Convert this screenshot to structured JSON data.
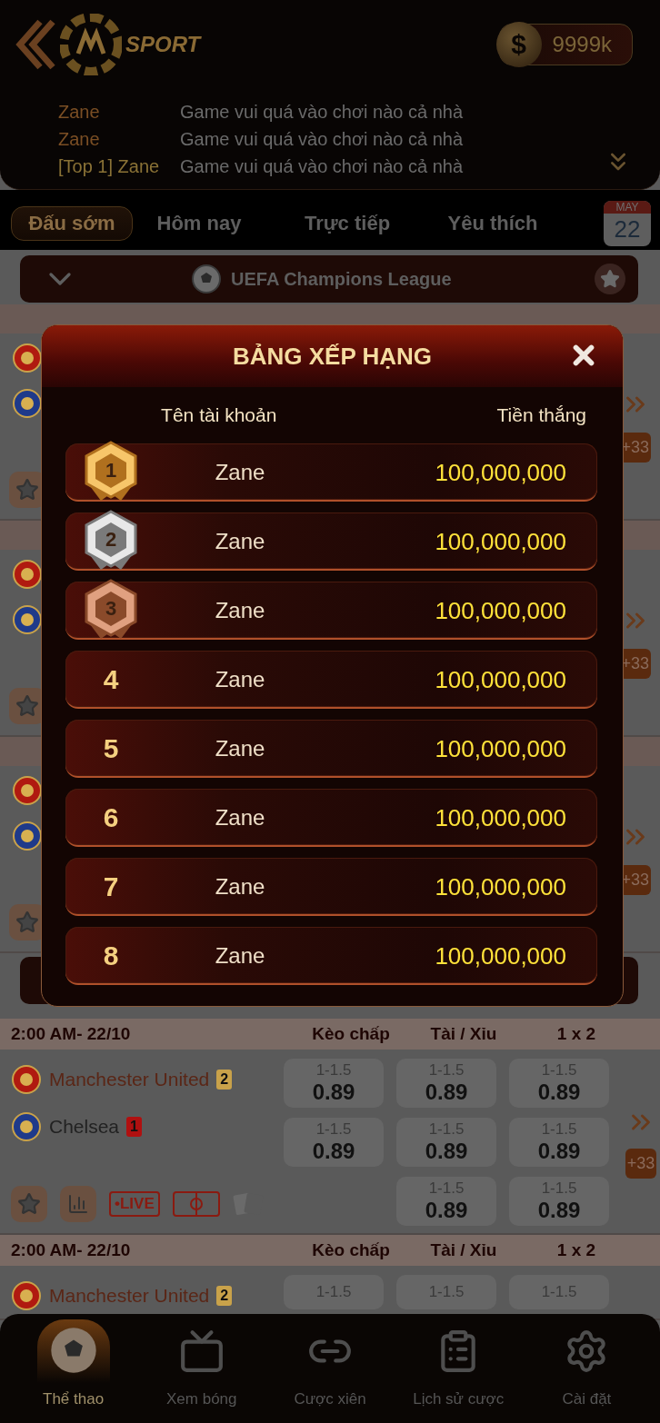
{
  "header": {
    "brand": "SPORT",
    "currency_symbol": "$",
    "balance": "9999k"
  },
  "chat": [
    {
      "user": "Zane",
      "message": "Game vui quá vào chơi nào cả nhà",
      "highlight": false
    },
    {
      "user": "Zane",
      "message": "Game vui quá vào chơi nào cả nhà",
      "highlight": false
    },
    {
      "user": "[Top 1] Zane",
      "message": "Game vui quá vào chơi nào cả nhà",
      "highlight": true
    }
  ],
  "tabs": [
    {
      "label": "Đấu sớm",
      "selected": true
    },
    {
      "label": "Hôm nay",
      "selected": false
    },
    {
      "label": "Trực tiếp",
      "selected": false
    },
    {
      "label": "Yêu thích",
      "selected": false
    }
  ],
  "calendar": {
    "month": "MAY",
    "day": "22"
  },
  "league": {
    "name": "UEFA Champions League"
  },
  "hidden_matches": [
    {
      "more": "+33"
    },
    {
      "more": "+33"
    },
    {
      "more": "+33"
    }
  ],
  "matches": [
    {
      "time": "2:00 AM- 22/10",
      "teams": [
        {
          "name": "Manchester United",
          "card": "2",
          "color": "#c9a24a",
          "kind": "red-devil"
        },
        {
          "name": "Chelsea",
          "card": "1",
          "color": "#b01010",
          "kind": "lion"
        }
      ],
      "markets": [
        {
          "title": "Kèo chấp",
          "odds": [
            {
              "line": "1-1.5",
              "price": "0.89"
            },
            {
              "line": "1-1.5",
              "price": "0.89"
            }
          ]
        },
        {
          "title": "Tài / Xỉu",
          "odds": [
            {
              "line": "1-1.5",
              "price": "0.89"
            },
            {
              "line": "1-1.5",
              "price": "0.89"
            },
            {
              "line": "1-1.5",
              "price": "0.89"
            }
          ]
        },
        {
          "title": "1 x 2",
          "odds": [
            {
              "line": "1-1.5",
              "price": "0.89"
            },
            {
              "line": "1-1.5",
              "price": "0.89"
            },
            {
              "line": "1-1.5",
              "price": "0.89"
            }
          ]
        }
      ],
      "live": "•LIVE",
      "more": "+33"
    },
    {
      "time": "2:00 AM- 22/10",
      "teams": [
        {
          "name": "Manchester United",
          "card": "2",
          "color": "#c9a24a",
          "kind": "red-devil"
        }
      ],
      "markets": [
        {
          "title": "Kèo chấp",
          "odds": [
            {
              "line": "1-1.5"
            }
          ]
        },
        {
          "title": "Tài / Xỉu",
          "odds": [
            {
              "line": "1-1.5"
            }
          ]
        },
        {
          "title": "1 x 2",
          "odds": [
            {
              "line": "1-1.5"
            }
          ]
        }
      ]
    }
  ],
  "leaderboard": {
    "title": "BẢNG XẾP HẠNG",
    "columns": [
      "Tên tài khoản",
      "Tiền thắng"
    ],
    "rows": [
      {
        "rank": "1",
        "kind": "gold",
        "name": "Zane",
        "amount": "100,000,000"
      },
      {
        "rank": "2",
        "kind": "silver",
        "name": "Zane",
        "amount": "100,000,000"
      },
      {
        "rank": "3",
        "kind": "bronze",
        "name": "Zane",
        "amount": "100,000,000"
      },
      {
        "rank": "4",
        "kind": "plain",
        "name": "Zane",
        "amount": "100,000,000"
      },
      {
        "rank": "5",
        "kind": "plain",
        "name": "Zane",
        "amount": "100,000,000"
      },
      {
        "rank": "6",
        "kind": "plain",
        "name": "Zane",
        "amount": "100,000,000"
      },
      {
        "rank": "7",
        "kind": "plain",
        "name": "Zane",
        "amount": "100,000,000"
      },
      {
        "rank": "8",
        "kind": "plain",
        "name": "Zane",
        "amount": "100,000,000"
      }
    ]
  },
  "nav": [
    {
      "label": "Thể thao",
      "kind": "sports",
      "selected": true
    },
    {
      "label": "Xem bóng",
      "kind": "tv",
      "selected": false
    },
    {
      "label": "Cược xiên",
      "kind": "parlay",
      "selected": false
    },
    {
      "label": "Lịch sử cược",
      "kind": "history",
      "selected": false
    },
    {
      "label": "Cài đặt",
      "kind": "settings",
      "selected": false
    }
  ]
}
